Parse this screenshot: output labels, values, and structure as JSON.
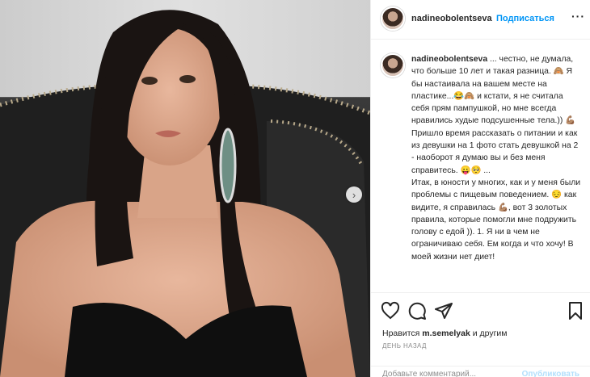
{
  "post": {
    "username": "nadineobolentseva",
    "follow_label": "Подписаться",
    "dot": "•",
    "more_label": "···",
    "next_arrow": "›",
    "caption_text": " ... честно, не думала, что больше 10 лет и такая разница. 🙈 Я бы настаивала на вашем месте на пластике...😂🙈 и кстати, я не считала себя прям пампушкой, но мне всегда нравились худые подсушенные тела.)) 💪🏽 Пришло время рассказать о питании и как из девушки на 1 фото стать девушкой на 2 - наоборот я думаю вы и без меня справитесь. 😛🥺 ...\nИтак, в юности у многих, как и у меня были проблемы с пищевым поведением. 😔 как видите, я справилась 💪🏽, вот 3 золотых правила, которые помогли мне подружить голову с едой )). 1. Я ни в чем не ограничиваю себя. Ем когда и что хочу! В моей жизни нет диет!",
    "likes_prefix": "Нравится ",
    "likes_user": "m.semelyak",
    "likes_suffix": " и другим",
    "time_label": "ДЕНЬ НАЗАД",
    "comment_placeholder": "Добавьте комментарий...",
    "publish_label": "Опубликовать"
  },
  "colors": {
    "accent": "#0095f6",
    "text": "#262626",
    "muted": "#8e8e8e"
  },
  "icons": [
    "heart-icon",
    "comment-icon",
    "share-icon",
    "bookmark-icon",
    "chevron-right-icon"
  ]
}
